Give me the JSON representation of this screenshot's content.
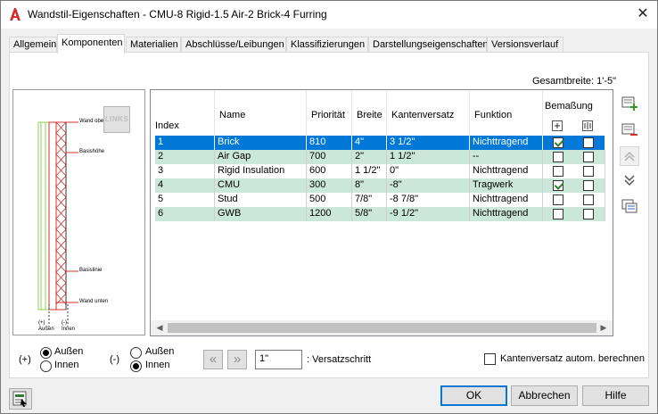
{
  "window": {
    "title": "Wandstil-Eigenschaften - CMU-8 Rigid-1.5 Air-2 Brick-4 Furring",
    "close_icon": "close-icon",
    "app_icon": "autocad-a-icon"
  },
  "tabs": [
    "Allgemein",
    "Komponenten",
    "Materialien",
    "Abschlüsse/Leibungen",
    "Klassifizierungen",
    "Darstellungseigenschaften",
    "Versionsverlauf"
  ],
  "active_tab": "Komponenten",
  "gesamtbreite": "Gesamtbreite: 1'-5\"",
  "preview": {
    "links_label": "LINKS",
    "labels": {
      "wand_oben": "Wand oben",
      "basishoehe": "Basishöhe",
      "basislinie": "Basislinie",
      "wand_unten": "Wand unten",
      "aussen": "(+)\nAußen",
      "innen": "(-)\nInnen"
    }
  },
  "table": {
    "headers": {
      "index": "Index",
      "name": "Name",
      "prioritaet": "Priorität",
      "breite": "Breite",
      "kantenversatz": "Kantenversatz",
      "funktion": "Funktion",
      "bemassung": "Bemaßung"
    },
    "rows": [
      {
        "index": "1",
        "name": "Brick",
        "prioritaet": "810",
        "breite": "4\"",
        "kantenversatz": "3 1/2\"",
        "funktion": "Nichttragend",
        "b1": true,
        "b2": false
      },
      {
        "index": "2",
        "name": "Air Gap",
        "prioritaet": "700",
        "breite": "2\"",
        "kantenversatz": "1 1/2\"",
        "funktion": "--",
        "b1": false,
        "b2": false
      },
      {
        "index": "3",
        "name": "Rigid Insulation",
        "prioritaet": "600",
        "breite": "1 1/2\"",
        "kantenversatz": "0\"",
        "funktion": "Nichttragend",
        "b1": false,
        "b2": false
      },
      {
        "index": "4",
        "name": "CMU",
        "prioritaet": "300",
        "breite": "8\"",
        "kantenversatz": "-8\"",
        "funktion": "Tragwerk",
        "b1": true,
        "b2": false
      },
      {
        "index": "5",
        "name": "Stud",
        "prioritaet": "500",
        "breite": "7/8\"",
        "kantenversatz": "-8 7/8\"",
        "funktion": "Nichttragend",
        "b1": false,
        "b2": false
      },
      {
        "index": "6",
        "name": "GWB",
        "prioritaet": "1200",
        "breite": "5/8\"",
        "kantenversatz": "-9 1/2\"",
        "funktion": "Nichttragend",
        "b1": false,
        "b2": false
      }
    ]
  },
  "side_buttons": [
    "add-component-icon",
    "remove-component-icon",
    "move-up-icon",
    "move-down-icon",
    "copy-component-icon"
  ],
  "options": {
    "plus_sign": "(+)",
    "minus_sign": "(-)",
    "aussen": "Außen",
    "innen": "Innen",
    "plus_selected": "Außen",
    "minus_selected": "Innen"
  },
  "versatz": {
    "value": "1\"",
    "label": ": Versatzschritt",
    "prev_icon": "double-chevron-left-icon",
    "next_icon": "double-chevron-right-icon"
  },
  "autocalc": {
    "label": "Kantenversatz autom. berechnen",
    "checked": false
  },
  "buttons": {
    "ok": "OK",
    "cancel": "Abbrechen",
    "help": "Hilfe"
  },
  "colors": {
    "selection": "#0078d7",
    "alt_row": "#cbe7d9",
    "accent_red": "#d32f2f"
  }
}
